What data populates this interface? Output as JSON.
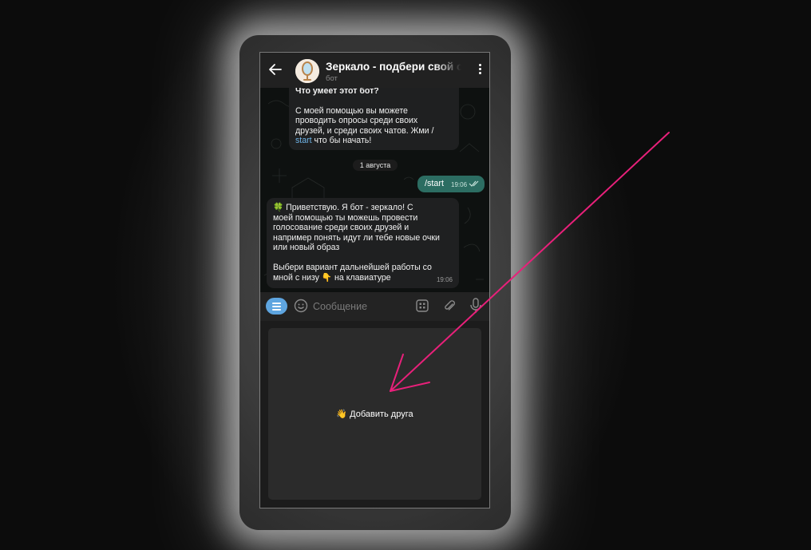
{
  "header": {
    "title": "Зеркало - подбери свой образ",
    "subtitle": "бот"
  },
  "chat": {
    "intro_message": {
      "heading": "Что умеет этот бот?",
      "lines": [
        "С моей помощью вы можете",
        "проводить опросы среди своих",
        "друзей, и среди своих чатов. Жми /"
      ],
      "last_line_link": "start",
      "last_line_rest": " что бы начать!"
    },
    "date_separator": "1 августа",
    "outgoing": {
      "text": "/start",
      "time": "19:06"
    },
    "bot_reply": {
      "lines": [
        "🍀 Приветствую. Я бот - зеркало! С",
        "моей помощью ты можешь провести",
        "голосование среди своих друзей и",
        "например понять идут ли тебе новые очки",
        "или новый образ",
        "",
        "Выбери вариант дальнейшей работы со",
        "мной с низу 👇 на клавиатуре"
      ],
      "time": "19:06"
    }
  },
  "input": {
    "placeholder": "Сообщение"
  },
  "keyboard": {
    "buttons": [
      "👋 Добавить друга"
    ]
  },
  "colors": {
    "annotation_arrow": "#e8207a",
    "outgoing_bubble": "#2c6d62",
    "link": "#6fb3e6",
    "menu_button": "#5ea5e0"
  }
}
